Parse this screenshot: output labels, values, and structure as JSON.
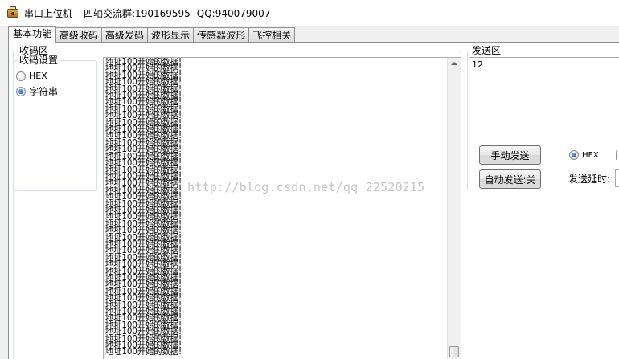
{
  "window": {
    "title": "串口上位机",
    "group_info": "四轴交流群:190169595",
    "qq_info": "QQ:940079007"
  },
  "tabs": [
    {
      "label": "基本功能",
      "active": true
    },
    {
      "label": "高级收码",
      "active": false
    },
    {
      "label": "高级发码",
      "active": false
    },
    {
      "label": "波形显示",
      "active": false
    },
    {
      "label": "传感器波形",
      "active": false
    },
    {
      "label": "飞控相关",
      "active": false
    }
  ],
  "receive": {
    "group_label": "收码区",
    "settings_label": "收码设置",
    "options": [
      {
        "label": "HEX",
        "checked": false
      },
      {
        "label": "字符串",
        "checked": true
      }
    ],
    "line_text": "地址100开始的数据!",
    "visible_line_count": 44
  },
  "send": {
    "group_label": "发送区",
    "content": "12",
    "manual_send_label": "手动发送",
    "auto_send_label": "自动发送:关",
    "hex_label": "HEX",
    "hex_checked": true,
    "delay_label": "发送延时:"
  },
  "watermark": "http://blog.csdn.net/qq_22520215",
  "colors": {
    "border": "#8e8f8f",
    "group_border": "#d5dfe5",
    "radio_checked": "#1d4f9c"
  }
}
